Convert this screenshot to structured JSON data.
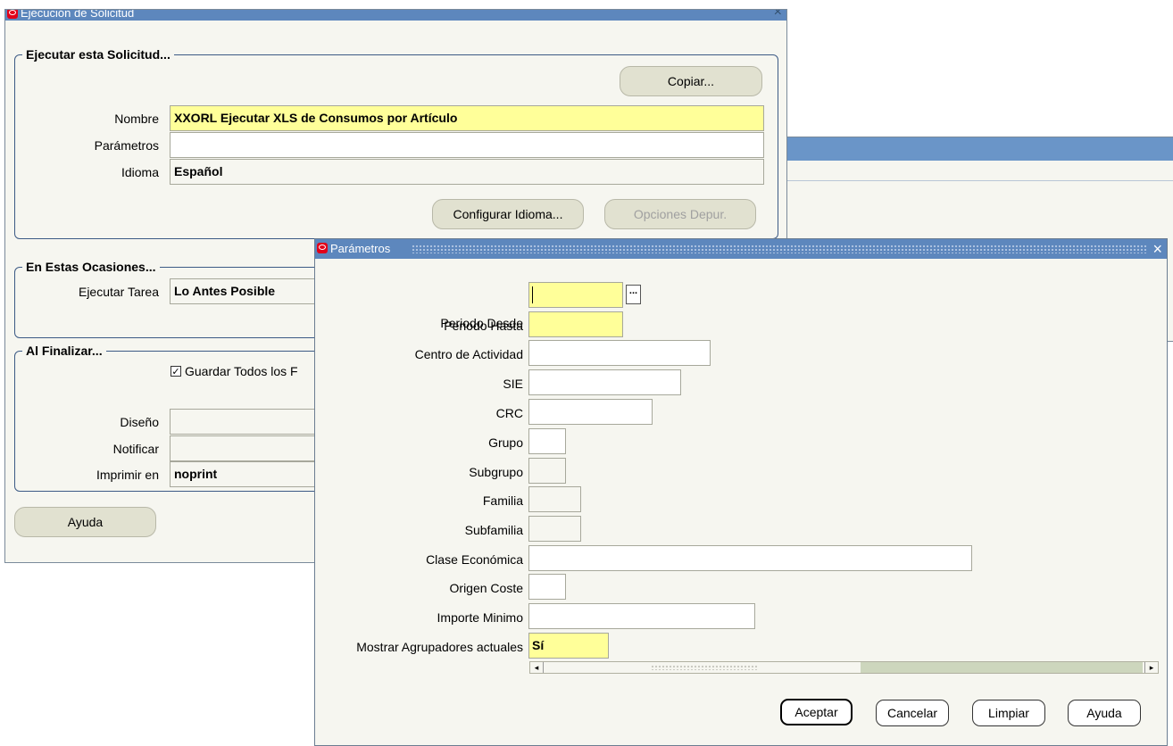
{
  "bg_window": {
    "title": "Ejecución de Solicitud",
    "close": "×",
    "run_group": {
      "title": "Ejecutar esta Solicitud...",
      "copy_button": "Copiar...",
      "name_label": "Nombre",
      "name_value": "XXORL Ejecutar XLS de Consumos por Artículo",
      "params_label": "Parámetros",
      "params_value": "",
      "language_label": "Idioma",
      "language_value": "Español",
      "config_language_button": "Configurar Idioma...",
      "debug_options_button": "Opciones Depur."
    },
    "schedule_group": {
      "title": "En Estas Ocasiones...",
      "run_task_label": "Ejecutar Tarea",
      "run_task_value": "Lo Antes Posible"
    },
    "completion_group": {
      "title": "Al Finalizar...",
      "save_files_label": "Guardar Todos los F",
      "save_files_checked": true,
      "layout_label": "Diseño",
      "layout_value": "",
      "notify_label": "Notificar",
      "notify_value": "",
      "print_label": "Imprimir en",
      "print_value": "noprint"
    },
    "help_button": "Ayuda"
  },
  "params_dialog": {
    "title": "Parámetros",
    "close": "×",
    "fields": [
      {
        "label": "Periodo Desde",
        "value": "",
        "required": true
      },
      {
        "label": "Periodo Hasta",
        "value": "",
        "required": true
      },
      {
        "label": "Centro de Actividad",
        "value": ""
      },
      {
        "label": "SIE",
        "value": ""
      },
      {
        "label": "CRC",
        "value": ""
      },
      {
        "label": "Grupo",
        "value": ""
      },
      {
        "label": "Subgrupo",
        "value": ""
      },
      {
        "label": "Familia",
        "value": ""
      },
      {
        "label": "Subfamilia",
        "value": ""
      },
      {
        "label": "Clase Económica",
        "value": ""
      },
      {
        "label": "Origen Coste",
        "value": ""
      },
      {
        "label": "Importe Minimo",
        "value": ""
      },
      {
        "label": "Mostrar Agrupadores actuales",
        "value": "Sí",
        "required": true
      }
    ],
    "lov_button": "...",
    "scroll_left": "◂",
    "scroll_right": "▸",
    "buttons": {
      "accept": "Aceptar",
      "cancel": "Cancelar",
      "clear": "Limpiar",
      "help": "Ayuda"
    }
  },
  "colors": {
    "titlebar": "#5d87bd",
    "required_field": "#ffff99",
    "window_bg": "#f6f6f0",
    "button": "#e1e1d0"
  }
}
